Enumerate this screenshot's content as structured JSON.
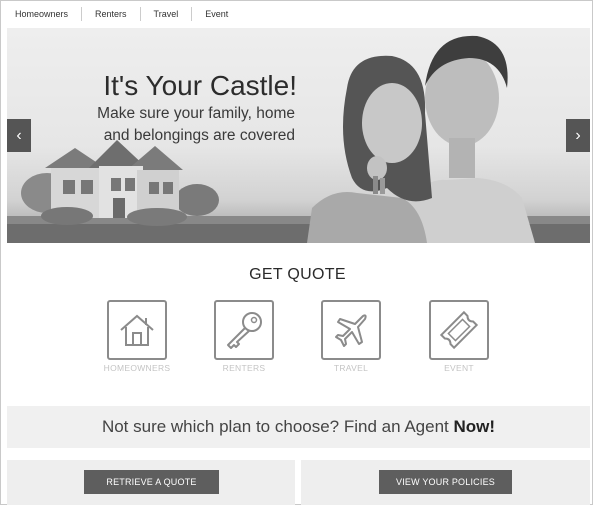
{
  "nav": {
    "tabs": [
      "Homeowners",
      "Renters",
      "Travel",
      "Event"
    ]
  },
  "hero": {
    "title": "It's Your Castle!",
    "subtitle_line1": "Make sure your family, home",
    "subtitle_line2": "and belongings are covered",
    "prev_arrow": "‹",
    "next_arrow": "›"
  },
  "quote": {
    "title": "GET QUOTE",
    "items": [
      {
        "label": "HOMEOWNERS",
        "icon": "house-icon"
      },
      {
        "label": "RENTERS",
        "icon": "key-icon"
      },
      {
        "label": "TRAVEL",
        "icon": "airplane-icon"
      },
      {
        "label": "EVENT",
        "icon": "ticket-icon"
      }
    ]
  },
  "agent": {
    "text": "Not sure which plan to choose? Find an Agent ",
    "emphasis": "Now!"
  },
  "actions": {
    "retrieve_label": "RETRIEVE A QUOTE",
    "policies_label": "VIEW YOUR POLICIES"
  },
  "colors": {
    "button": "#5e5e5e",
    "panel": "#eeeeee",
    "icon_border": "#8b8b8b",
    "icon_label": "#c4c4c4"
  }
}
